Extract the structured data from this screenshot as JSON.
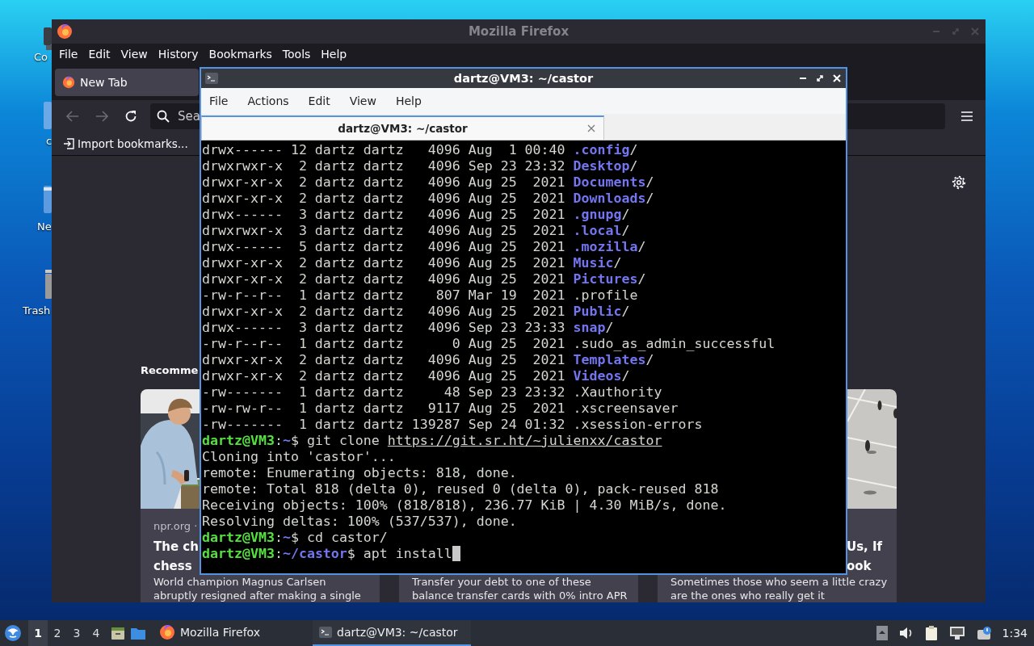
{
  "desktop": {
    "icons": [
      {
        "label": "Co"
      },
      {
        "label": "c"
      },
      {
        "label": "Ne"
      },
      {
        "label": "Trash"
      }
    ]
  },
  "firefox": {
    "title": "Mozilla Firefox",
    "menu": [
      "File",
      "Edit",
      "View",
      "History",
      "Bookmarks",
      "Tools",
      "Help"
    ],
    "tab": {
      "label": "New Tab",
      "selected": true
    },
    "search": {
      "placeholder": "Sea"
    },
    "bookmark": "Import bookmarks...",
    "heading": "Recomme",
    "cards": [
      {
        "image": {
          "kind": "picture"
        },
        "source": "npr.org ·",
        "title_lines": [
          "The ch",
          "chess"
        ],
        "description_lines": [
          "World champion Magnus Carlsen",
          "abruptly resigned after making a single"
        ]
      },
      {
        "description_lines": [
          "Transfer your debt to one of these",
          "balance transfer cards with 0% intro APR"
        ]
      },
      {
        "image": {
          "kind": "picture"
        },
        "title_lines": [
          "Us, If",
          "ook"
        ],
        "description_lines": [
          "Sometimes those who seem a little crazy",
          "are the ones who really get it"
        ]
      }
    ]
  },
  "terminal": {
    "title": "dartz@VM3: ~/castor",
    "menu": [
      "File",
      "Actions",
      "Edit",
      "View",
      "Help"
    ],
    "tab": {
      "label": "dartz@VM3: ~/castor",
      "selected": true
    },
    "lines": [
      {
        "kind": "entry",
        "meta": "drwx------ 12 dartz dartz   4096 Aug  1 00:40 ",
        "name": ".config",
        "dir": true,
        "suffix": "/"
      },
      {
        "kind": "entry",
        "meta": "drwxrwxr-x  2 dartz dartz   4096 Sep 23 23:32 ",
        "name": "Desktop",
        "dir": true,
        "suffix": "/"
      },
      {
        "kind": "entry",
        "meta": "drwxr-xr-x  2 dartz dartz   4096 Aug 25  2021 ",
        "name": "Documents",
        "dir": true,
        "suffix": "/"
      },
      {
        "kind": "entry",
        "meta": "drwxr-xr-x  2 dartz dartz   4096 Aug 25  2021 ",
        "name": "Downloads",
        "dir": true,
        "suffix": "/"
      },
      {
        "kind": "entry",
        "meta": "drwx------  3 dartz dartz   4096 Aug 25  2021 ",
        "name": ".gnupg",
        "dir": true,
        "suffix": "/"
      },
      {
        "kind": "entry",
        "meta": "drwxrwxr-x  3 dartz dartz   4096 Aug 25  2021 ",
        "name": ".local",
        "dir": true,
        "suffix": "/"
      },
      {
        "kind": "entry",
        "meta": "drwx------  5 dartz dartz   4096 Aug 25  2021 ",
        "name": ".mozilla",
        "dir": true,
        "suffix": "/"
      },
      {
        "kind": "entry",
        "meta": "drwxr-xr-x  2 dartz dartz   4096 Aug 25  2021 ",
        "name": "Music",
        "dir": true,
        "suffix": "/"
      },
      {
        "kind": "entry",
        "meta": "drwxr-xr-x  2 dartz dartz   4096 Aug 25  2021 ",
        "name": "Pictures",
        "dir": true,
        "suffix": "/"
      },
      {
        "kind": "entry",
        "meta": "-rw-r--r--  1 dartz dartz    807 Mar 19  2021 ",
        "name": ".profile",
        "dir": false
      },
      {
        "kind": "entry",
        "meta": "drwxr-xr-x  2 dartz dartz   4096 Aug 25  2021 ",
        "name": "Public",
        "dir": true,
        "suffix": "/"
      },
      {
        "kind": "entry",
        "meta": "drwx------  3 dartz dartz   4096 Sep 23 23:33 ",
        "name": "snap",
        "dir": true,
        "suffix": "/"
      },
      {
        "kind": "entry",
        "meta": "-rw-r--r--  1 dartz dartz      0 Aug 25  2021 ",
        "name": ".sudo_as_admin_successful",
        "dir": false
      },
      {
        "kind": "entry",
        "meta": "drwxr-xr-x  2 dartz dartz   4096 Aug 25  2021 ",
        "name": "Templates",
        "dir": true,
        "suffix": "/"
      },
      {
        "kind": "entry",
        "meta": "drwxr-xr-x  2 dartz dartz   4096 Aug 25  2021 ",
        "name": "Videos",
        "dir": true,
        "suffix": "/"
      },
      {
        "kind": "entry",
        "meta": "-rw-------  1 dartz dartz     48 Sep 23 23:32 ",
        "name": ".Xauthority",
        "dir": false
      },
      {
        "kind": "entry",
        "meta": "-rw-rw-r--  1 dartz dartz   9117 Aug 25  2021 ",
        "name": ".xscreensaver",
        "dir": false
      },
      {
        "kind": "entry",
        "meta": "-rw-------  1 dartz dartz 139287 Sep 24 01:32 ",
        "name": ".xsession-errors",
        "dir": false
      },
      {
        "kind": "prompt",
        "user": "dartz@VM3",
        "separator": ":",
        "path": "~",
        "symbol": "$",
        "command": "git clone",
        "link": "https://git.sr.ht/~julienxx/castor"
      },
      {
        "kind": "output",
        "text": "Cloning into 'castor'..."
      },
      {
        "kind": "output",
        "text": "remote: Enumerating objects: 818, done."
      },
      {
        "kind": "output",
        "text": "remote: Total 818 (delta 0), reused 0 (delta 0), pack-reused 818"
      },
      {
        "kind": "output",
        "text": "Receiving objects: 100% (818/818), 236.77 KiB | 4.30 MiB/s, done."
      },
      {
        "kind": "output",
        "text": "Resolving deltas: 100% (537/537), done."
      },
      {
        "kind": "prompt",
        "user": "dartz@VM3",
        "separator": ":",
        "path": "~",
        "symbol": "$",
        "command": "cd castor/"
      },
      {
        "kind": "prompt",
        "user": "dartz@VM3",
        "separator": ":",
        "path": "~/castor",
        "symbol": "$",
        "command": "apt install",
        "cursor": true
      }
    ]
  },
  "taskbar": {
    "workspaces": [
      {
        "label": "1",
        "selected": true
      },
      {
        "label": "2",
        "selected": false
      },
      {
        "label": "3",
        "selected": false
      },
      {
        "label": "4",
        "selected": false
      }
    ],
    "tasks": [
      {
        "kind": "browser",
        "label": "Mozilla Firefox",
        "selected": false
      },
      {
        "kind": "terminal",
        "label": "dartz@VM3: ~/castor",
        "selected": true
      }
    ],
    "clock": "1:34"
  }
}
